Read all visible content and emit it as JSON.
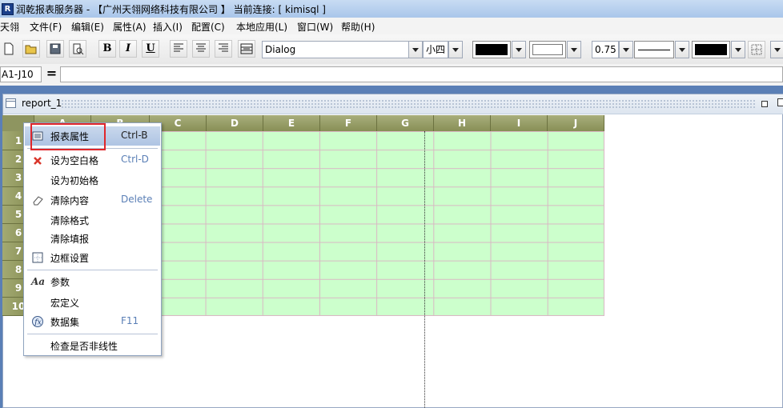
{
  "window": {
    "title": "润乾报表服务器 - 【广州天翎网络科技有限公司 】   当前连接: [ kimisql ]",
    "app_icon": "R"
  },
  "menu": {
    "items": [
      "天翎",
      "文件(F)",
      "编辑(E)",
      "属性(A)",
      "插入(I)",
      "配置(C)",
      "本地应用(L)",
      "窗口(W)",
      "帮助(H)"
    ]
  },
  "toolbar": {
    "bold_label": "B",
    "italic_label": "I",
    "underline_label": "U",
    "font_family": "Dialog",
    "font_size": "小四",
    "border_width": "0.75",
    "font_color": "#000000",
    "back_color": "#ffffff",
    "border_color": "#000000"
  },
  "formula_bar": {
    "cell_reference": "A1-J10",
    "equals_label": "=",
    "formula_value": ""
  },
  "document": {
    "tab_title": "report_1"
  },
  "grid": {
    "columns": [
      "A",
      "B",
      "C",
      "D",
      "E",
      "F",
      "G",
      "H",
      "I",
      "J"
    ],
    "rows": [
      "1",
      "2",
      "3",
      "4",
      "5",
      "6",
      "7",
      "8",
      "9",
      "10"
    ]
  },
  "context_menu": {
    "items": [
      {
        "label": "报表属性",
        "shortcut": "Ctrl-B",
        "icon": "report-properties-icon"
      },
      {
        "label": "设为空白格",
        "shortcut": "Ctrl-D",
        "icon": "red-x-icon"
      },
      {
        "label": "设为初始格",
        "shortcut": "",
        "icon": ""
      },
      {
        "label": "清除内容",
        "shortcut": "Delete",
        "icon": "eraser-icon"
      },
      {
        "label": "清除格式",
        "shortcut": "",
        "icon": ""
      },
      {
        "label": "清除填报",
        "shortcut": "",
        "icon": ""
      },
      {
        "label": "边框设置",
        "shortcut": "",
        "icon": "border-grid-icon"
      },
      {
        "label": "参数",
        "shortcut": "",
        "icon": "parameter-aa-icon"
      },
      {
        "label": "宏定义",
        "shortcut": "",
        "icon": ""
      },
      {
        "label": "数据集",
        "shortcut": "F11",
        "icon": "dataset-icon"
      },
      {
        "label": "检查是否非线性",
        "shortcut": "",
        "icon": ""
      }
    ]
  },
  "colors": {
    "cell_fill": "#ccffcc",
    "header_olive": "#8e9560",
    "highlight_red": "#e0262b",
    "shortcut_blue": "#5a7fb6"
  }
}
